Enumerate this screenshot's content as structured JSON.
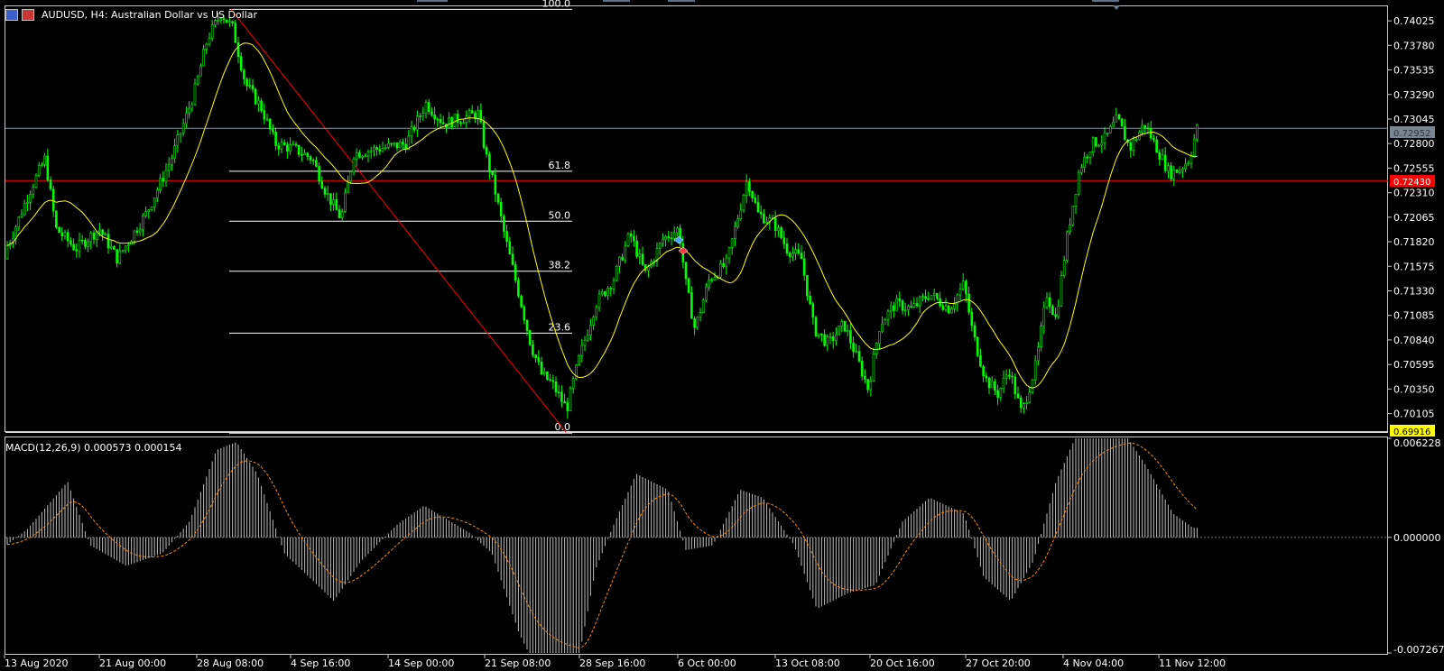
{
  "header": {
    "symbol": "AUDUSD, H4:  Australian Dollar vs US Dollar",
    "flags": [
      "au-flag-icon",
      "us-flag-icon"
    ]
  },
  "price_axis": {
    "ticks": [
      "0.74025",
      "0.73780",
      "0.73535",
      "0.73290",
      "0.73045",
      "0.72800",
      "0.72555",
      "0.72310",
      "0.72065",
      "0.71820",
      "0.71575",
      "0.71330",
      "0.71085",
      "0.70840",
      "0.70595",
      "0.70350",
      "0.70105"
    ],
    "current_bid": "0.72952",
    "red_level": "0.72430",
    "yellow_level": "0.69916"
  },
  "time_axis": {
    "labels": [
      "13 Aug 2020",
      "21 Aug 00:00",
      "28 Aug 08:00",
      "4 Sep 16:00",
      "14 Sep 00:00",
      "21 Sep 08:00",
      "28 Sep 16:00",
      "6 Oct 00:00",
      "13 Oct 08:00",
      "20 Oct 16:00",
      "27 Oct 20:00",
      "4 Nov 04:00",
      "11 Nov 12:00"
    ]
  },
  "fibonacci": {
    "levels": [
      "100.0",
      "61.8",
      "50.0",
      "38.2",
      "23.6",
      "0.0"
    ],
    "high": 0.7414,
    "low": 0.6991
  },
  "macd": {
    "label": "MACD(12,26,9) 0.000573 0.000154",
    "ticks": [
      "0.006228",
      "0.000000",
      "-0.007267"
    ]
  },
  "colors": {
    "background": "#000000",
    "candles": "#00ff00",
    "ma_line": "#ffff00",
    "fib_line": "#ffffff",
    "trend_line": "#ff0000",
    "macd_hist": "#c0c0c0",
    "macd_signal": "#ff8c00",
    "bid_label_bg": "#7b8592",
    "red_label_bg": "#ff0000",
    "yellow_label_bg": "#ffff00"
  },
  "chart_data": {
    "type": "line",
    "series_description": "AUDUSD H4 closing prices (approximate, sampled)",
    "x": [
      "13 Aug 2020",
      "21 Aug 00:00",
      "28 Aug 08:00",
      "4 Sep 16:00",
      "14 Sep 00:00",
      "21 Sep 08:00",
      "28 Sep 16:00",
      "6 Oct 00:00",
      "13 Oct 08:00",
      "20 Oct 16:00",
      "27 Oct 20:00",
      "4 Nov 04:00",
      "11 Nov 12:00"
    ],
    "close": [
      0.7162,
      0.7185,
      0.7395,
      0.7265,
      0.7295,
      0.7205,
      0.7095,
      0.718,
      0.7175,
      0.709,
      0.704,
      0.725,
      0.7295
    ],
    "ylim": [
      0.6991,
      0.7414
    ],
    "macd_values": [
      0.0,
      0.0005,
      0.0055,
      -0.0015,
      0.0012,
      -0.006,
      0.0025,
      0.001,
      0.0015,
      -0.003,
      -0.0025,
      0.006,
      0.0006
    ],
    "macd_ylim": [
      -0.007267,
      0.006228
    ]
  }
}
